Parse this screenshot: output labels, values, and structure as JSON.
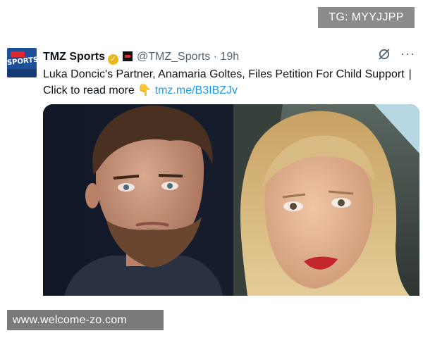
{
  "watermarks": {
    "top": "TG: MYYJJPP",
    "bottom": "www.welcome-zo.com"
  },
  "tweet": {
    "avatar": {
      "brand": "TMZ",
      "text": "SPORTS"
    },
    "author": "TMZ Sports",
    "verified_icon": "verified-badge-icon",
    "affiliate_icon": "tmz-affiliate-icon",
    "handle": "@TMZ_Sports",
    "separator": "·",
    "time": "19h",
    "headline": "Luka Doncic's Partner, Anamaria Goltes, Files Petition For Child Support",
    "cursor": "|",
    "cta": "Click to read more",
    "pointing_emoji": "👇",
    "link": "tmz.me/B3IBZJv",
    "media_alt": "Photo of Luka Doncic and Anamaria Goltes side by side"
  },
  "colors": {
    "verified": "#e8b91c",
    "link": "#1d9bf0",
    "muted": "#536471",
    "tmz_red": "#e3262b"
  }
}
